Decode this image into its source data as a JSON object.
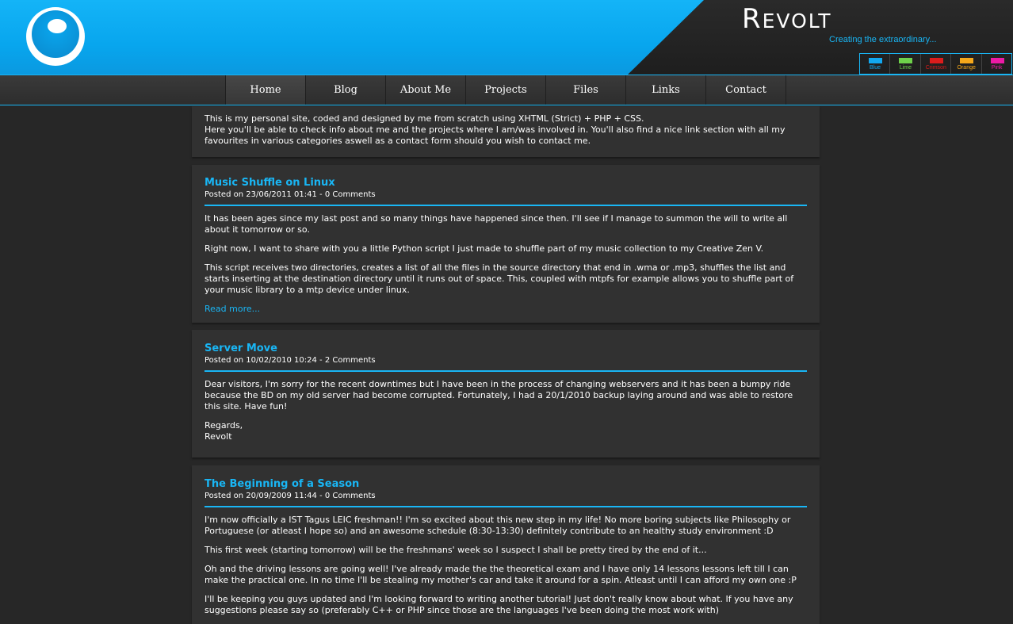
{
  "header": {
    "title_cap": "R",
    "title_rest": "EVOLT",
    "tagline": "Creating the extraordinary..."
  },
  "themes": [
    {
      "label": "Blue",
      "color": "#12a8f0"
    },
    {
      "label": "Lime",
      "color": "#6ed24a"
    },
    {
      "label": "Crimson",
      "color": "#dc1c1c"
    },
    {
      "label": "Orange",
      "color": "#f6a81a"
    },
    {
      "label": "Pink",
      "color": "#ec1aa6"
    }
  ],
  "nav": {
    "items": [
      "Home",
      "Blog",
      "About Me",
      "Projects",
      "Files",
      "Links",
      "Contact"
    ]
  },
  "intro": {
    "line1": "This is my personal site, coded and designed by me from scratch using XHTML (Strict) + PHP + CSS.",
    "line2": "Here you'll be able to check info about me and the projects where I am/was involved in. You'll also find a nice link section with all my favourites in various categories aswell as a contact form should you wish to contact me."
  },
  "posts": [
    {
      "title": "Music Shuffle on Linux",
      "meta": "Posted on 23/06/2011 01:41 - 0 Comments",
      "paragraphs": [
        "It has been ages since my last post and so many things have happened since then. I'll see if I manage to summon the will to write all about it tomorrow or so.",
        "Right now, I want to share with you a little Python script I just made to shuffle part of my music collection to my Creative Zen V.",
        "This script receives two directories, creates a list of all the files in the source directory that end in .wma or .mp3, shuffles the list and starts inserting at the destination directory until it runs out of space. This, coupled with mtpfs for example allows you to shuffle part of your music library to a mtp device under linux."
      ],
      "read_more": "Read more..."
    },
    {
      "title": "Server Move",
      "meta": "Posted on 10/02/2010 10:24 - 2 Comments",
      "paragraphs": [
        "Dear visitors, I'm sorry for the recent downtimes but I have been in the process of changing webservers and it has been a bumpy ride because the BD on my old server had become corrupted. Fortunately, I had a 20/1/2010 backup laying around and was able to restore this site. Have fun!"
      ],
      "signoff_1": "Regards,",
      "signoff_2": "Revolt"
    },
    {
      "title": "The Beginning of a Season",
      "meta": "Posted on 20/09/2009 11:44 - 0 Comments",
      "paragraphs": [
        "I'm now officially a IST Tagus LEIC freshman!! I'm so excited about this new step in my life! No more boring subjects like Philosophy or Portuguese (or atleast I hope so) and an awesome schedule (8:30-13:30) definitely contribute to an healthy study environment :D",
        "This first week (starting tomorrow) will be the freshmans' week so I suspect I shall be pretty tired by the end of it...",
        "Oh and the driving lessons are going well! I've already made the the theoretical exam and I have only 14 lessons lessons left till I can make the practical one. In no time I'll be stealing my mother's car and take it around for a spin. Atleast until I can afford my own one :P",
        "I'll be keeping you guys updated and I'm looking forward to writing another tutorial! Just don't really know about what. If you have any suggestions please say so (preferably C++ or PHP since those are the languages I've been doing the most work with)"
      ]
    }
  ]
}
